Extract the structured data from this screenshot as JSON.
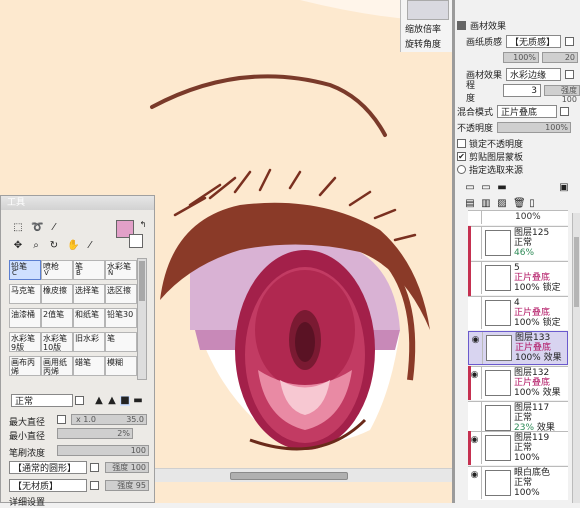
{
  "navigator": {
    "zoom_label": "缩放倍率",
    "rotate_label": "旋转角度"
  },
  "effects_panel": {
    "title": "画材效果",
    "paper_label": "画纸质感",
    "paper_value": "【无质感】",
    "paper_strength": "100%",
    "paper_strength2": "20",
    "effect_label": "画材效果",
    "effect_value": "水彩边缘",
    "effect_degree_label": "程度",
    "effect_degree_value": "3",
    "effect_strength": "强度 100",
    "blend_label": "混合模式",
    "blend_value": "正片叠底",
    "opacity_label": "不透明度",
    "opacity_value": "100%",
    "lock_opacity": "锁定不透明度",
    "clip_group": "剪贴图层蒙板",
    "clip_checked": "✔",
    "select_source": "指定选取来源"
  },
  "layers": [
    {
      "name": "",
      "mode": "",
      "opacity": "100%",
      "tail": ""
    },
    {
      "name": "图层125",
      "mode": "正常",
      "opacity": "46%",
      "tail": ""
    },
    {
      "name": "5",
      "mode": "正片叠底",
      "opacity": "100%",
      "tail": "锁定"
    },
    {
      "name": "4",
      "mode": "正片叠底",
      "opacity": "100%",
      "tail": "锁定"
    },
    {
      "name": "图层133",
      "mode": "正片叠底",
      "opacity": "100%",
      "tail": "效果"
    },
    {
      "name": "图层132",
      "mode": "正片叠底",
      "opacity": "100%",
      "tail": "效果"
    },
    {
      "name": "图层117",
      "mode": "正常",
      "opacity": "23%",
      "tail": "效果"
    },
    {
      "name": "图层119",
      "mode": "正常",
      "opacity": "100%",
      "tail": ""
    },
    {
      "name": "眼白底色",
      "mode": "正常",
      "opacity": "100%",
      "tail": ""
    }
  ],
  "tool_panel": {
    "title": "工具",
    "tools": [
      {
        "label": "铅笔",
        "key": "C"
      },
      {
        "label": "喷枪",
        "key": "V"
      },
      {
        "label": "笔",
        "key": "B"
      },
      {
        "label": "水彩笔",
        "key": "N"
      },
      {
        "label": "马克笔",
        "key": ""
      },
      {
        "label": "橡皮擦",
        "key": ""
      },
      {
        "label": "选择笔",
        "key": ""
      },
      {
        "label": "选区擦",
        "key": ""
      },
      {
        "label": "油漆桶",
        "key": ""
      },
      {
        "label": "2值笔",
        "key": ""
      },
      {
        "label": "和纸笔",
        "key": ""
      },
      {
        "label": "铅笔30",
        "key": ""
      },
      {
        "label": "水彩笔9版",
        "key": ""
      },
      {
        "label": "水彩笔10版",
        "key": ""
      },
      {
        "label": "旧水彩",
        "key": ""
      },
      {
        "label": "笔",
        "key": ""
      },
      {
        "label": "画布丙烯",
        "key": ""
      },
      {
        "label": "画用纸丙烯",
        "key": ""
      },
      {
        "label": "蜡笔",
        "key": ""
      },
      {
        "label": "模糊",
        "key": ""
      }
    ],
    "mode_value": "正常",
    "max_size_label": "最大直径",
    "max_size_mult": "x 1.0",
    "max_size_value": "35.0",
    "min_size_label": "最小直径",
    "min_size_value": "2%",
    "density_label": "笔刷浓度",
    "density_value": "100",
    "shape_value": "【通常的圆形】",
    "shape_strength": "强度 100",
    "texture_value": "【无材质】",
    "texture_strength": "强度 95",
    "bottom_label": "详细设置"
  },
  "colors": {
    "main": "#e2a0c8",
    "sub": "#ffffff",
    "canvas": "#fde9cf"
  }
}
